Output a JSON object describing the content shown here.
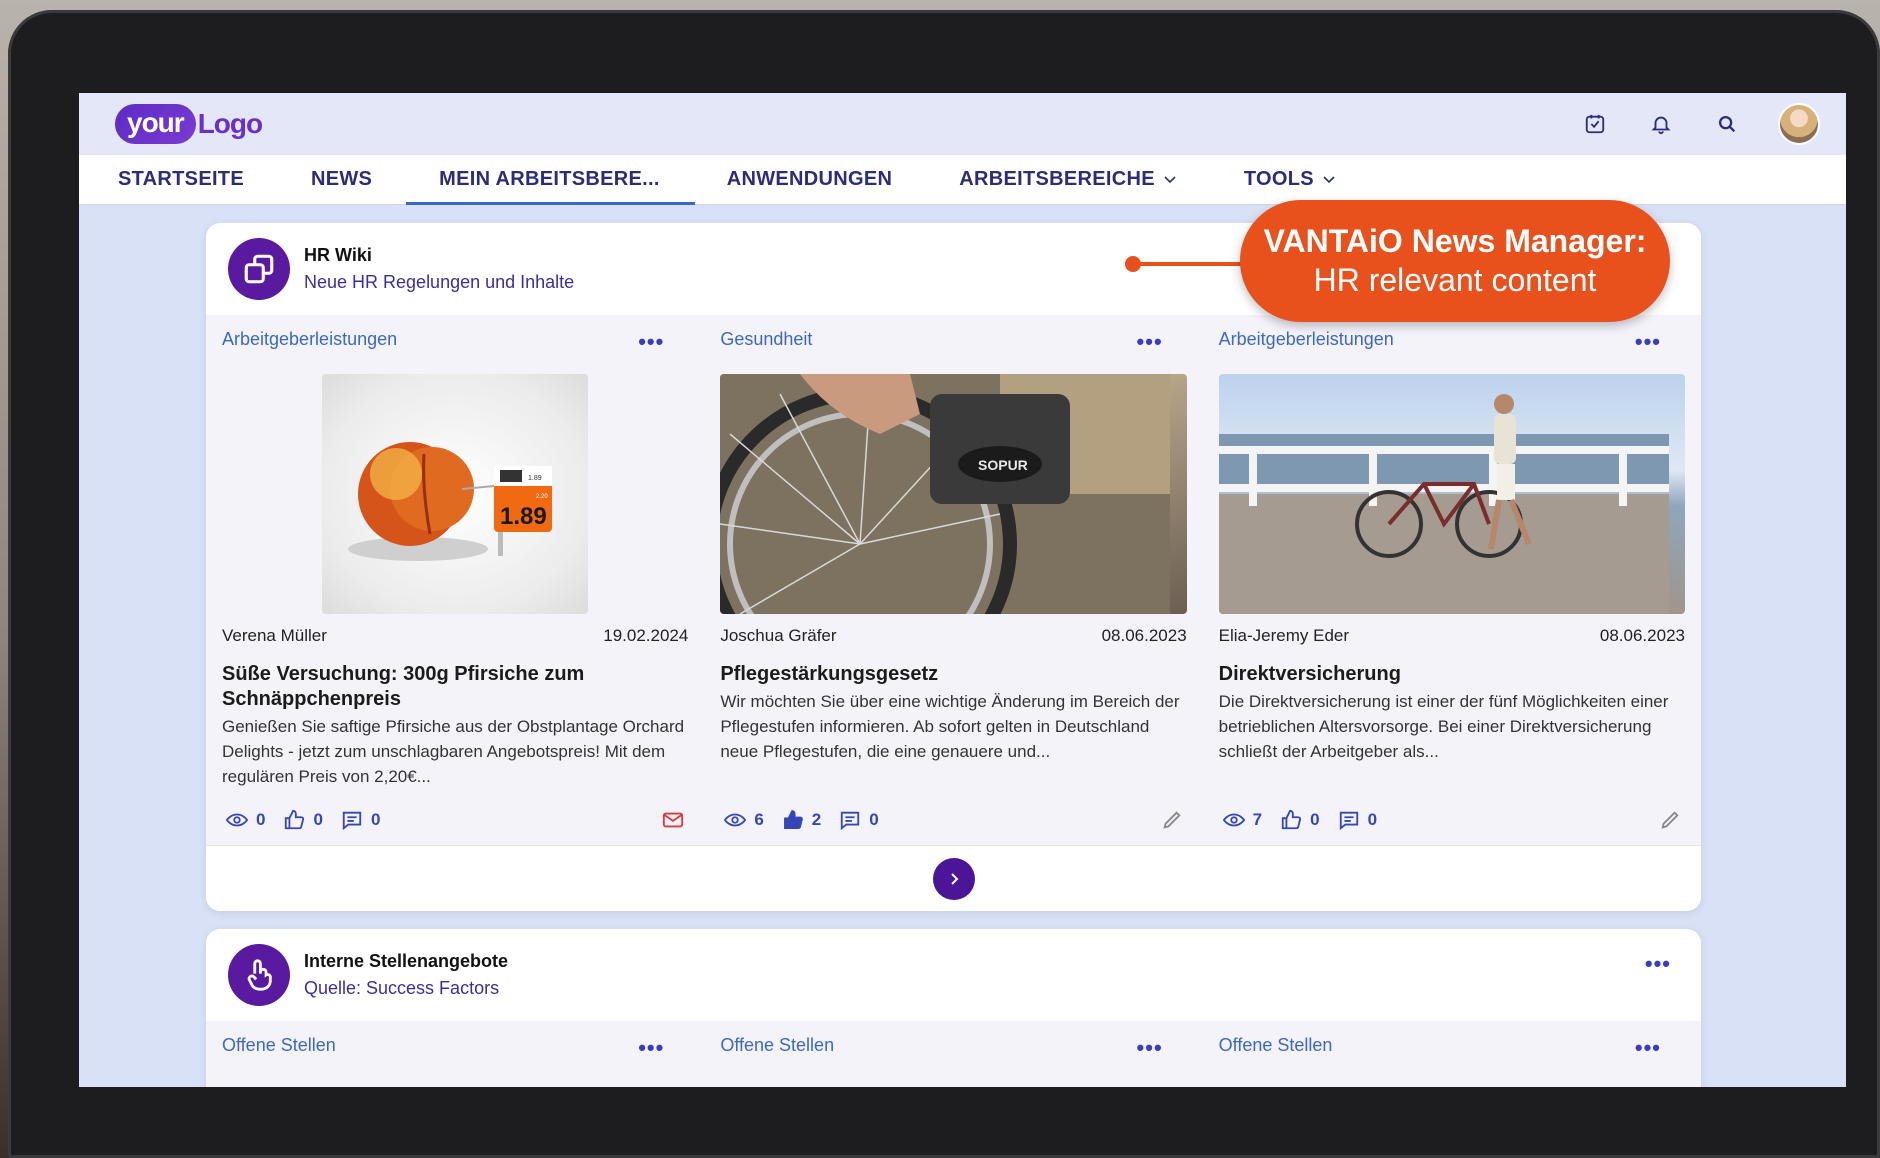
{
  "header": {
    "logo_part1": "your",
    "logo_part2": "Logo"
  },
  "nav": {
    "items": [
      {
        "label": "STARTSEITE"
      },
      {
        "label": "NEWS"
      },
      {
        "label": "MEIN ARBEITSBERE..."
      },
      {
        "label": "ANWENDUNGEN"
      },
      {
        "label": "ARBEITSBEREICHE"
      },
      {
        "label": "TOOLS"
      }
    ]
  },
  "callout": {
    "line1": "VANTAiO News Manager:",
    "line2": "HR relevant content"
  },
  "hrwiki": {
    "title": "HR Wiki",
    "subtitle": "Neue HR Regelungen und Inhalte",
    "articles": [
      {
        "category": "Arbeitgeberleistungen",
        "author": "Verena Müller",
        "date": "19.02.2024",
        "title": "Süße Versuchung: 300g Pfirsiche zum Schnäppchenpreis",
        "text": "Genießen Sie saftige Pfirsiche aus der Obstplantage Orchard Delights - jetzt zum unschlagbaren Angebotspreis! Mit dem regulären Preis von 2,20€...",
        "views": "0",
        "likes": "0",
        "comments": "0",
        "price": "1.89",
        "price_small": "1.89",
        "price_old": "2.20"
      },
      {
        "category": "Gesundheit",
        "author": "Joschua Gräfer",
        "date": "08.06.2023",
        "title": "Pflegestärkungsgesetz",
        "text": "Wir möchten Sie über eine wichtige Änderung im Bereich der Pflegestufen informieren. Ab sofort gelten in Deutschland neue Pflegestufen, die eine genauere und...",
        "views": "6",
        "likes": "2",
        "comments": "0",
        "wheel_brand": "SOPUR"
      },
      {
        "category": "Arbeitgeberleistungen",
        "author": "Elia-Jeremy Eder",
        "date": "08.06.2023",
        "title": "Direktversicherung",
        "text": "Die Direktversicherung ist einer der fünf Möglichkeiten einer betrieblichen Altersvorsorge. Bei einer Direktversicherung schließt der Arbeitgeber als...",
        "views": "7",
        "likes": "0",
        "comments": "0"
      }
    ]
  },
  "jobs": {
    "title": "Interne Stellenangebote",
    "subtitle": "Quelle: Success Factors",
    "categories": [
      "Offene Stellen",
      "Offene Stellen",
      "Offene Stellen"
    ]
  },
  "colors": {
    "accent": "#4a1596",
    "nav_text": "#2b2d7a",
    "callout": "#e8501c",
    "link": "#3b68c6"
  }
}
